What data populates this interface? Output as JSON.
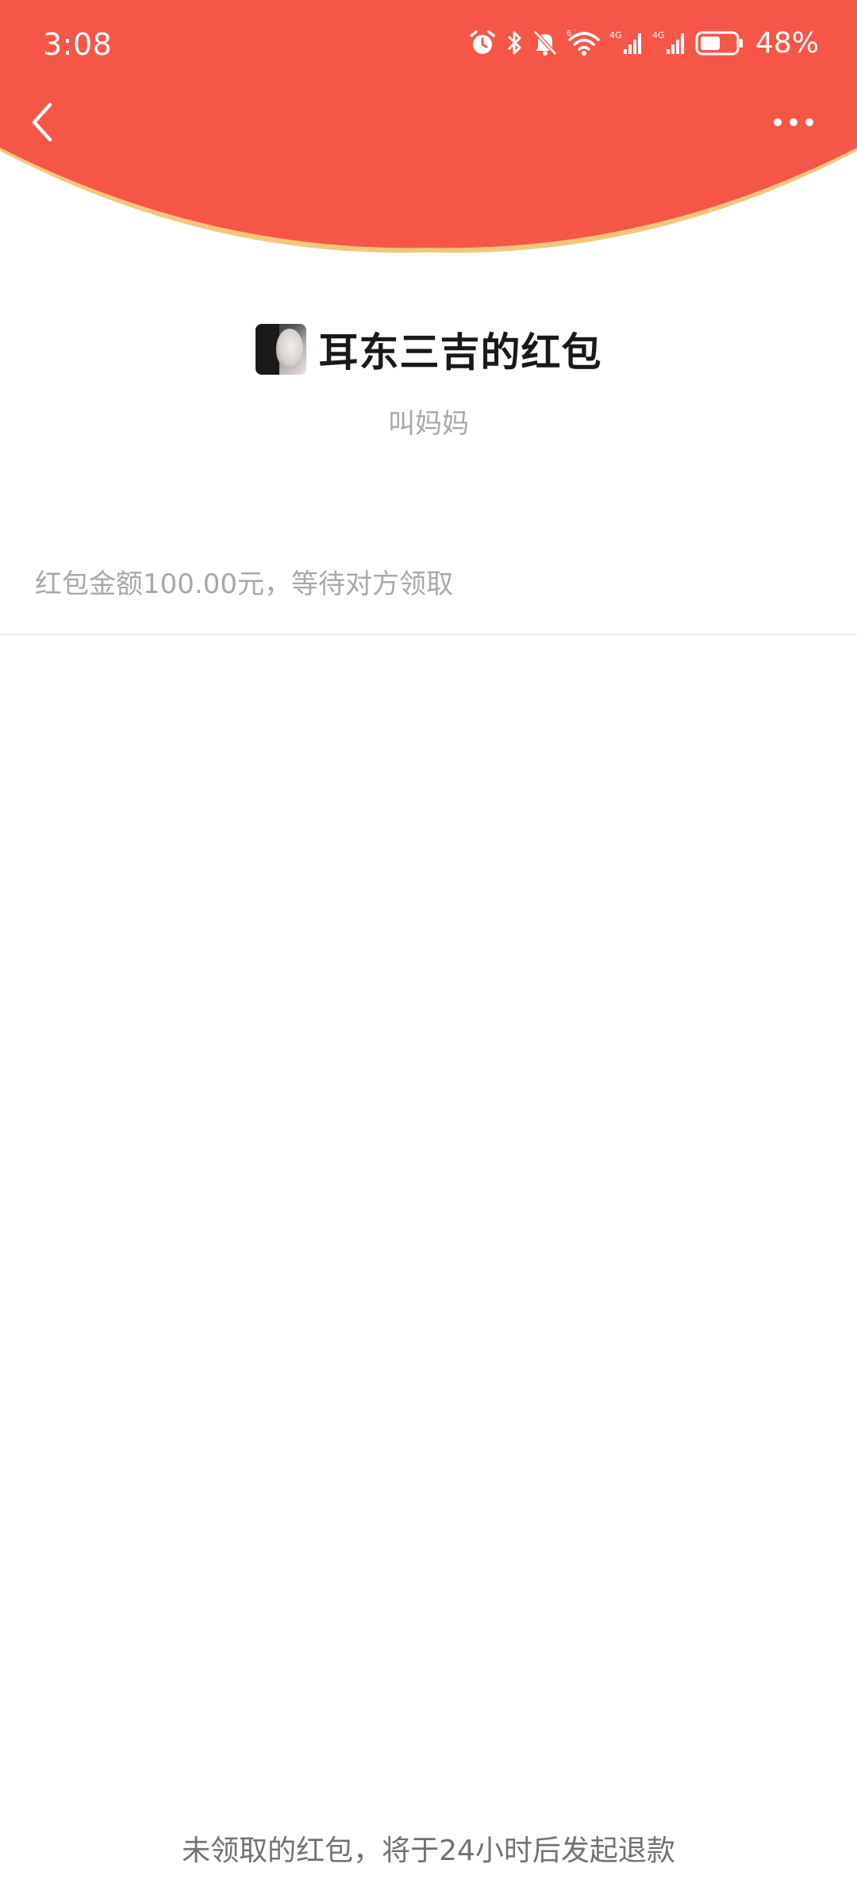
{
  "status_bar": {
    "time": "3:08",
    "battery_percent": "48%",
    "signal_1_label": "4G",
    "signal_2_label": "4G",
    "wifi_label": "6",
    "icons": [
      "alarm-icon",
      "bluetooth-icon",
      "bell-muted-icon",
      "wifi-icon",
      "signal-icon",
      "signal-icon",
      "battery-icon"
    ]
  },
  "nav": {
    "back_icon": "chevron-left-icon",
    "more_icon": "more-dots-icon"
  },
  "red_packet": {
    "sender_title": "耳东三吉的红包",
    "message": "叫妈妈",
    "amount_status": "红包金额100.00元，等待对方领取",
    "refund_note": "未领取的红包，将于24小时后发起退款"
  },
  "colors": {
    "header_red": "#F65648",
    "header_rim": "#F4C77E",
    "text_dark": "#191919",
    "text_gray": "#A8A8A8"
  }
}
